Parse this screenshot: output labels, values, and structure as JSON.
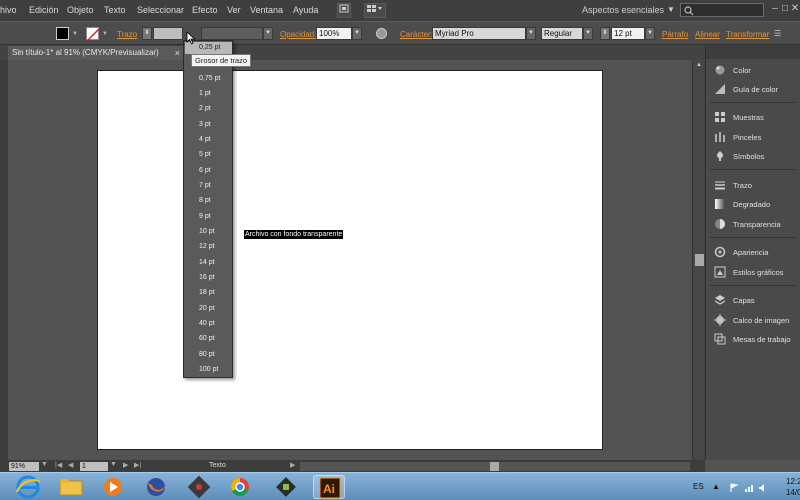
{
  "menubar": {
    "items": [
      "hivo",
      "Edición",
      "Objeto",
      "Texto",
      "Seleccionar",
      "Efecto",
      "Ver",
      "Ventana",
      "Ayuda"
    ],
    "workspace": "Aspectos esenciales",
    "workspace_arrow": "▼",
    "window_controls": [
      "–",
      "□",
      "✕"
    ]
  },
  "controlbar": {
    "stroke_label": "Trazo",
    "opacity_label": "Opacidad:",
    "opacity_value": "100%",
    "character_label": "Carácter:",
    "font_value": "Myriad Pro",
    "style_value": "Regular",
    "size_value": "12 pt",
    "paragraph_label": "Párrafo",
    "align_label": "Alinear",
    "transform_label": "Transformar",
    "colors": {
      "accent_orange": "#e2953b"
    }
  },
  "tab": {
    "title": "Sin título-1* al 91% (CMYK/Previsualizar)",
    "close": "×"
  },
  "artboard": {
    "selected_text": "Archivo con fondo transparente"
  },
  "stroke_dropdown": {
    "selected": "0,25 pt",
    "tooltip": "Grosor de trazo",
    "items": [
      "0,75 pt",
      "1 pt",
      "2 pt",
      "3 pt",
      "4 pt",
      "5 pt",
      "6 pt",
      "7 pt",
      "8 pt",
      "9 pt",
      "10 pt",
      "12 pt",
      "14 pt",
      "16 pt",
      "18 pt",
      "20 pt",
      "40 pt",
      "60 pt",
      "80 pt",
      "100 pt"
    ]
  },
  "rpanel": {
    "items": [
      {
        "label": "Color",
        "icon": "color-icon"
      },
      {
        "label": "Guía de color",
        "icon": "color-guide-icon"
      },
      {
        "label": "Muestras",
        "icon": "swatches-icon"
      },
      {
        "label": "Pinceles",
        "icon": "brushes-icon"
      },
      {
        "label": "Símbolos",
        "icon": "symbols-icon"
      },
      {
        "label": "Trazo",
        "icon": "stroke-icon"
      },
      {
        "label": "Degradado",
        "icon": "gradient-icon"
      },
      {
        "label": "Transparencia",
        "icon": "transparency-icon"
      },
      {
        "label": "Apariencia",
        "icon": "appearance-icon"
      },
      {
        "label": "Estilos gráficos",
        "icon": "graphic-styles-icon"
      },
      {
        "label": "Capas",
        "icon": "layers-icon"
      },
      {
        "label": "Calco de imagen",
        "icon": "image-trace-icon"
      },
      {
        "label": "Mesas de trabajo",
        "icon": "artboards-icon"
      }
    ]
  },
  "statusbar": {
    "zoom": "91%",
    "page": "1",
    "tool": "Texto"
  },
  "taskbar": {
    "language": "ES",
    "time": "12:2",
    "date": "14/0"
  }
}
